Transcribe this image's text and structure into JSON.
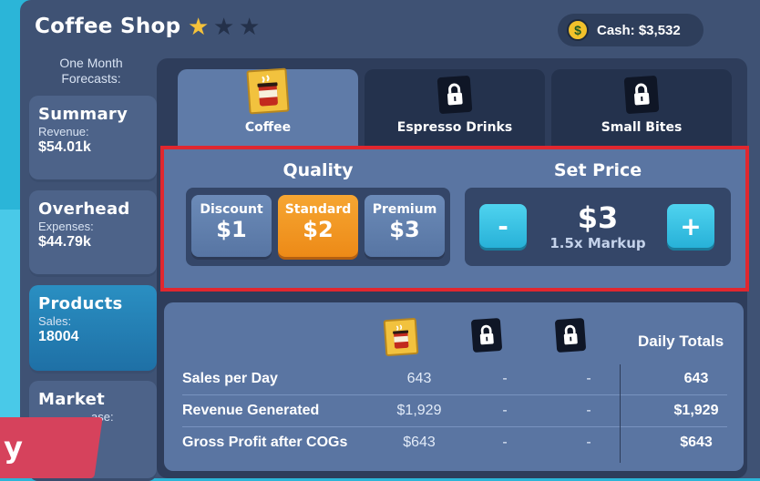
{
  "header": {
    "title": "Coffee Shop",
    "stars_filled": 1,
    "stars_total": 3,
    "cash_label": "Cash: $3,532",
    "coin_symbol": "$"
  },
  "sidebar": {
    "forecast_title": "One Month Forecasts:",
    "cards": [
      {
        "title": "Summary",
        "sub": "Revenue:",
        "value": "$54.01k"
      },
      {
        "title": "Overhead",
        "sub": "Expenses:",
        "value": "$44.79k"
      },
      {
        "title": "Products",
        "sub": "Sales:",
        "value": "18004"
      },
      {
        "title": "Market",
        "sub": "ase:",
        "value": ""
      }
    ],
    "badge_text": "y"
  },
  "tabs": [
    {
      "label": "Coffee",
      "locked": false
    },
    {
      "label": "Espresso Drinks",
      "locked": true
    },
    {
      "label": "Small Bites",
      "locked": true
    }
  ],
  "quality": {
    "title": "Quality",
    "options": [
      {
        "name": "Discount",
        "price": "$1"
      },
      {
        "name": "Standard",
        "price": "$2",
        "selected": true
      },
      {
        "name": "Premium",
        "price": "$3"
      }
    ]
  },
  "price": {
    "title": "Set Price",
    "value": "$3",
    "markup": "1.5x Markup",
    "minus": "-",
    "plus": "+"
  },
  "totals": {
    "daily_header": "Daily Totals",
    "rows": [
      {
        "label": "Sales per Day",
        "coffee": "643",
        "espresso": "-",
        "bites": "-",
        "total": "643"
      },
      {
        "label": "Revenue Generated",
        "coffee": "$1,929",
        "espresso": "-",
        "bites": "-",
        "total": "$1,929"
      },
      {
        "label": "Gross Profit after COGs",
        "coffee": "$643",
        "espresso": "-",
        "bites": "-",
        "total": "$643"
      }
    ]
  },
  "colors": {
    "accent_orange": "#ed8a17",
    "accent_cyan": "#27b1d8",
    "highlight_red": "#e0272f",
    "star_gold": "#f5c23a"
  }
}
